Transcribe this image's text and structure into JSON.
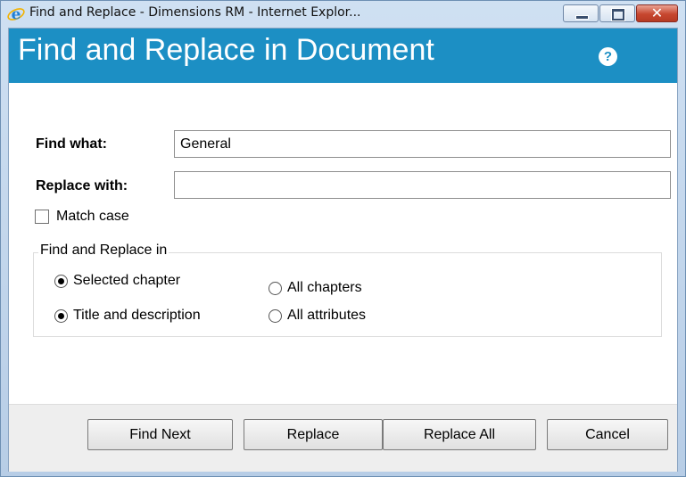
{
  "window": {
    "title": "Find and Replace - Dimensions RM - Internet Explor...",
    "icons": {
      "app": "internet-explorer-icon",
      "minimize": "minimize-icon",
      "maximize": "maximize-icon",
      "close": "close-icon"
    },
    "close_glyph": "✕"
  },
  "header": {
    "title": "Find and Replace in Document",
    "help_icon": "help-icon",
    "help_glyph": "?",
    "background_color": "#1c8fc4"
  },
  "form": {
    "find_label": "Find what:",
    "find_value": "General",
    "replace_label": "Replace with:",
    "replace_value": "",
    "match_case_label": "Match case",
    "match_case_checked": false
  },
  "scope": {
    "legend": "Find and Replace in",
    "options": [
      {
        "label": "Selected chapter",
        "checked": true
      },
      {
        "label": "All chapters",
        "checked": false
      },
      {
        "label": "Title and description",
        "checked": true
      },
      {
        "label": "All attributes",
        "checked": false
      }
    ]
  },
  "buttons": {
    "find_next": "Find Next",
    "replace": "Replace",
    "replace_all": "Replace All",
    "cancel": "Cancel"
  }
}
